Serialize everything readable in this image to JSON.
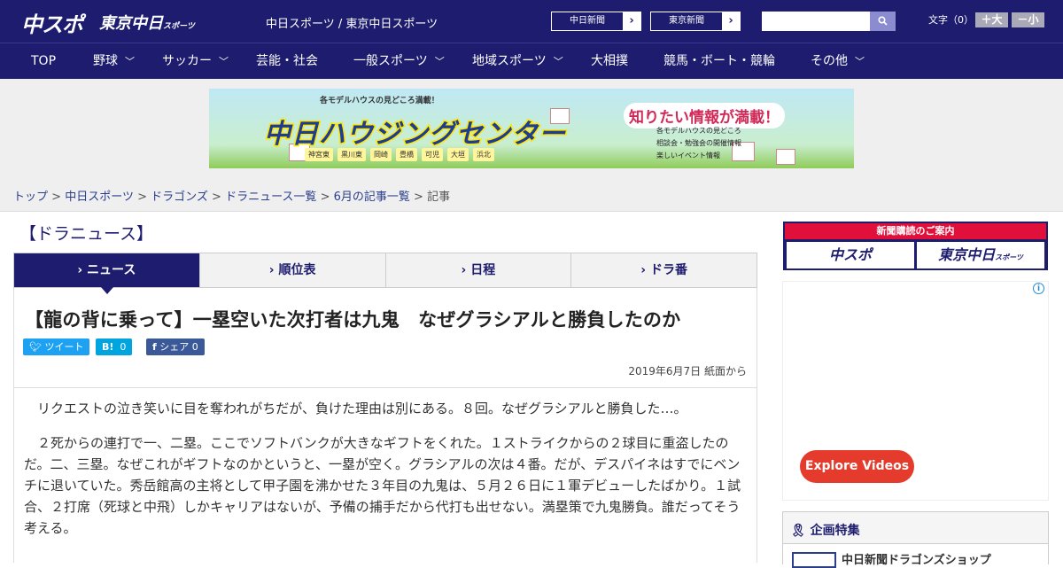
{
  "header": {
    "logo_chuspo": "中スポ",
    "logo_tokyo": "東京中日",
    "logo_tokyo_small": "スポーツ",
    "site_title": "中日スポーツ / 東京中日スポーツ",
    "paper_buttons": [
      "中日新聞",
      "東京新聞"
    ],
    "search_placeholder": "",
    "font_size_label": "文字（0）",
    "font_larger": "＋大",
    "font_smaller": "－小"
  },
  "nav": {
    "items": [
      {
        "label": "TOP",
        "chevron": false
      },
      {
        "label": "野球",
        "chevron": true
      },
      {
        "label": "サッカー",
        "chevron": true
      },
      {
        "label": "芸能・社会",
        "chevron": false
      },
      {
        "label": "一般スポーツ",
        "chevron": true
      },
      {
        "label": "地域スポーツ",
        "chevron": true
      },
      {
        "label": "大相撲",
        "chevron": false
      },
      {
        "label": "競馬・ボート・競輪",
        "chevron": false
      },
      {
        "label": "その他",
        "chevron": true
      }
    ]
  },
  "banner": {
    "top_text": "各モデルハウスの見どころ満載！",
    "main_text": "中日ハウジングセンター",
    "right_text": "知りたい情報が満載！",
    "list": [
      "各モデルハウスの見どころ",
      "相談会・勉強会の開催情報",
      "楽しいイベント情報"
    ],
    "tags": [
      "神宮東",
      "黒川東",
      "岡崎",
      "豊橋",
      "可児",
      "大垣",
      "浜北"
    ]
  },
  "breadcrumb": {
    "items": [
      "トップ",
      "中日スポーツ",
      "ドラゴンズ",
      "ドラニュース一覧",
      "6月の記事一覧"
    ],
    "current": "記事",
    "separator": ">"
  },
  "section_title": "【ドラニュース】",
  "tabs": [
    "ニュース",
    "順位表",
    "日程",
    "ドラ番"
  ],
  "article": {
    "headline": "【龍の背に乗って】一塁空いた次打者は九鬼　なぜグラシアルと勝負したのか",
    "share": {
      "tweet": "ツイート",
      "hatena": "B!",
      "hatena_count": "0",
      "facebook": "シェア",
      "facebook_count": "0"
    },
    "date": "2019年6月7日 紙面から",
    "paragraphs": [
      "リクエストの泣き笑いに目を奪われがちだが、負けた理由は別にある。８回。なぜグラシアルと勝負した…。",
      "２死からの連打で一、二塁。ここでソフトバンクが大きなギフトをくれた。１ストライクからの２球目に重盗したのだ。二、三塁。なぜこれがギフトなのかというと、一塁が空く。グラシアルの次は４番。だが、デスパイネはすでにベンチに退いていた。秀岳館高の主将として甲子園を沸かせた３年目の九鬼は、５月２６日に１軍デビューしたばかり。１試合、２打席（死球と中飛）しかキャリアはないが、予備の捕手だから代打も出せない。満塁策で九鬼勝負。誰だってそう考える。"
    ]
  },
  "sidebar": {
    "subscribe_head": "新聞購読のご案内",
    "subscribe_left": "中スポ",
    "subscribe_right": "東京中日",
    "subscribe_right_small": "スポーツ",
    "ad_info": "i",
    "explore": "Explore Videos",
    "special_title": "企画特集",
    "special_item": "中日新聞ドラゴンズショップ"
  },
  "colors": {
    "navy": "#1d1c6e",
    "red": "#e0103a",
    "twitter": "#1da1f2",
    "hatena": "#00a4de",
    "facebook": "#3b5998"
  }
}
